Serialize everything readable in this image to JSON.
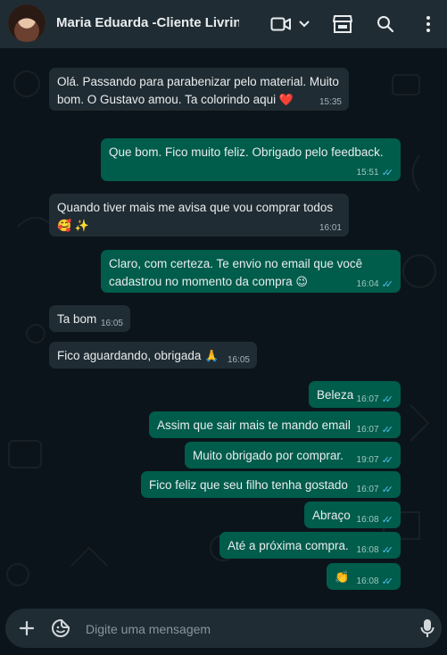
{
  "header": {
    "contact_name": "Maria Eduarda -Cliente Livrin",
    "icons": [
      "video-call-icon",
      "chevron-down-icon",
      "shop-icon",
      "search-icon",
      "more-options-icon"
    ]
  },
  "messages": [
    {
      "direction": "in",
      "text": "Olá. Passando para parabenizar pelo material. Muito bom. O Gustavo amou. Ta colorindo aqui",
      "emoji": "❤️",
      "time": "15:35"
    },
    {
      "direction": "out",
      "text": "Que bom. Fico muito feliz. Obrigado pelo feedback.",
      "time": "15:51",
      "status": "read"
    },
    {
      "direction": "in",
      "text": "Quando tiver mais me avisa que vou comprar todos",
      "emoji": "🥰 ✨",
      "time": "16:01"
    },
    {
      "direction": "out",
      "text": "Claro, com certeza. Te envio no email que você cadastrou no momento da compra",
      "emoji": "😉",
      "time": "16:04",
      "status": "read"
    },
    {
      "direction": "in",
      "text": "Ta bom",
      "time": "16:05"
    },
    {
      "direction": "in",
      "text": "Fico aguardando, obrigada",
      "emoji": "🙏",
      "time": "16:05"
    },
    {
      "direction": "out",
      "text": "Beleza",
      "time": "16:07",
      "status": "read"
    },
    {
      "direction": "out",
      "text": "Assim que sair mais te mando email",
      "time": "16:07",
      "status": "read"
    },
    {
      "direction": "out",
      "text": "Muito obrigado por comprar.",
      "time": "19:07",
      "status": "read"
    },
    {
      "direction": "out",
      "text": "Fico feliz que seu filho tenha gostado",
      "time": "16:07",
      "status": "read"
    },
    {
      "direction": "out",
      "text": "Abraço",
      "time": "16:08",
      "status": "read"
    },
    {
      "direction": "out",
      "text": "Até a próxima compra.",
      "time": "16:08",
      "status": "read"
    },
    {
      "direction": "out",
      "text": "",
      "emoji": "👏",
      "time": "16:08",
      "status": "read"
    }
  ],
  "composer": {
    "placeholder": "Digite uma mensagem",
    "icons": [
      "attach-plus-icon",
      "sticker-icon",
      "microphone-icon"
    ]
  },
  "colors": {
    "header_bg": "#202c33",
    "chat_bg": "#0b141a",
    "incoming_bubble": "#202c33",
    "outgoing_bubble": "#005c4b",
    "read_ticks": "#53bdeb"
  }
}
